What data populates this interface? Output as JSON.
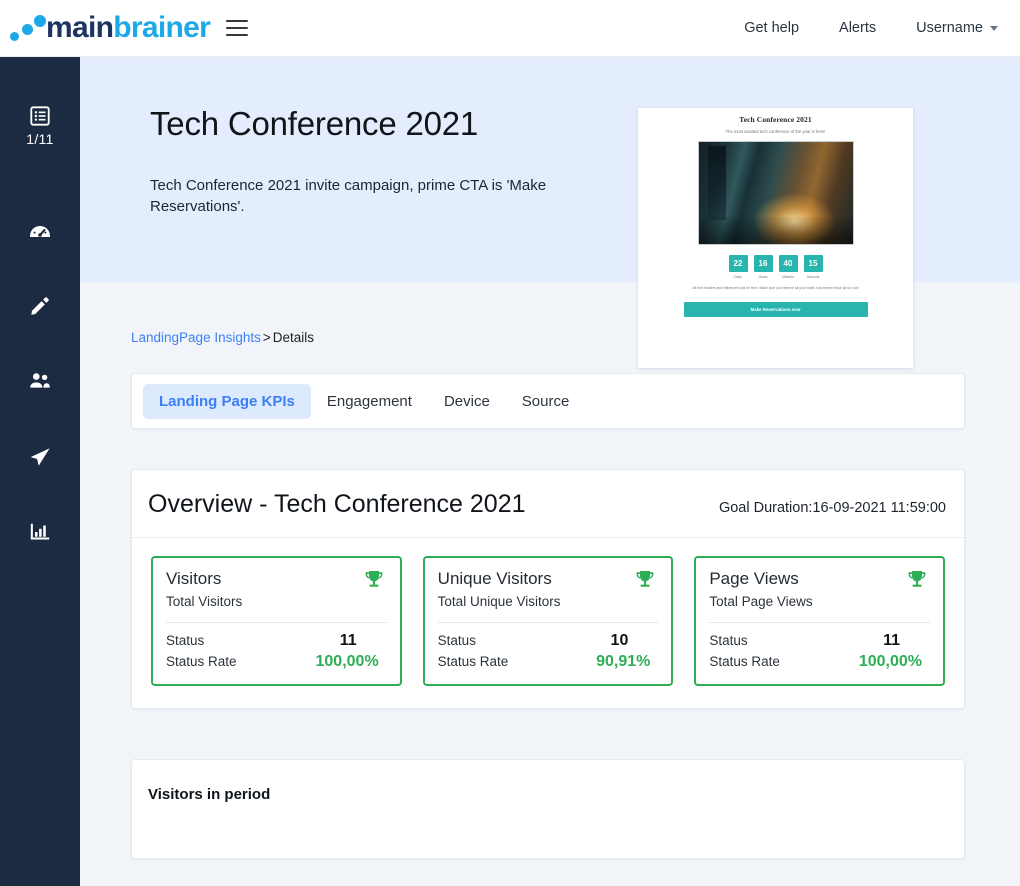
{
  "header": {
    "logo_main": "main",
    "logo_accent": "brainer",
    "menu_icon": "hamburger-icon",
    "nav": [
      {
        "label": "Get help",
        "name": "get-help"
      },
      {
        "label": "Alerts",
        "name": "alerts"
      },
      {
        "label": "Username",
        "name": "username"
      }
    ]
  },
  "sidebar": {
    "items": [
      {
        "icon": "list-icon",
        "name": "campaign-list",
        "count": "1/11"
      },
      {
        "icon": "dashboard-gauge-icon",
        "name": "dashboard",
        "count": ""
      },
      {
        "icon": "pencil-icon",
        "name": "edit",
        "count": ""
      },
      {
        "icon": "people-icon",
        "name": "audience",
        "count": ""
      },
      {
        "icon": "paper-plane-icon",
        "name": "send",
        "count": ""
      },
      {
        "icon": "bar-chart-icon",
        "name": "analytics",
        "count": ""
      }
    ]
  },
  "hero": {
    "title": "Tech Conference 2021",
    "description": "Tech Conference 2021 invite campaign, prime CTA is 'Make Reservations'.",
    "preview": {
      "heading": "Tech Conference 2021",
      "subheading": "The most awaited tech conference of the year is here!",
      "countdown": [
        {
          "value": "22",
          "label": "Days"
        },
        {
          "value": "16",
          "label": "Hours"
        },
        {
          "value": "40",
          "label": "Minutes"
        },
        {
          "value": "15",
          "label": "Seconds"
        }
      ],
      "note": "All tech leaders and influencers will be here. Make sure you reserve all your seats now before these all run out!",
      "cta": "Make Reservations now"
    }
  },
  "breadcrumb": {
    "link": "LandingPage Insights",
    "separator": ">",
    "current": "Details"
  },
  "tabs": [
    {
      "label": "Landing Page KPIs",
      "name": "landing-page-kpis",
      "active": true
    },
    {
      "label": "Engagement",
      "name": "engagement",
      "active": false
    },
    {
      "label": "Device",
      "name": "device",
      "active": false
    },
    {
      "label": "Source",
      "name": "source",
      "active": false
    }
  ],
  "overview": {
    "title": "Overview - Tech Conference 2021",
    "goal_duration": "Goal Duration:16-09-2021 11:59:00",
    "status_label": "Status",
    "status_rate_label": "Status Rate",
    "trophy_icon": "trophy-icon",
    "kpis": [
      {
        "name": "Visitors",
        "subtitle": "Total Visitors",
        "status": "11",
        "status_rate": "100,00%"
      },
      {
        "name": "Unique Visitors",
        "subtitle": "Total Unique Visitors",
        "status": "10",
        "status_rate": "90,91%"
      },
      {
        "name": "Page Views",
        "subtitle": "Total Page Views",
        "status": "11",
        "status_rate": "100,00%"
      }
    ]
  },
  "visitors_period": {
    "title": "Visitors in period"
  },
  "colors": {
    "sidebar": "#1c2b42",
    "hero_bg": "#e4edfd",
    "page_bg": "#f1f5f9",
    "accent_blue": "#3d7ff5",
    "logo_blue": "#1da9e8",
    "logo_navy": "#1d3461",
    "kpi_green": "#2eae56",
    "preview_teal": "#28b5ae"
  }
}
